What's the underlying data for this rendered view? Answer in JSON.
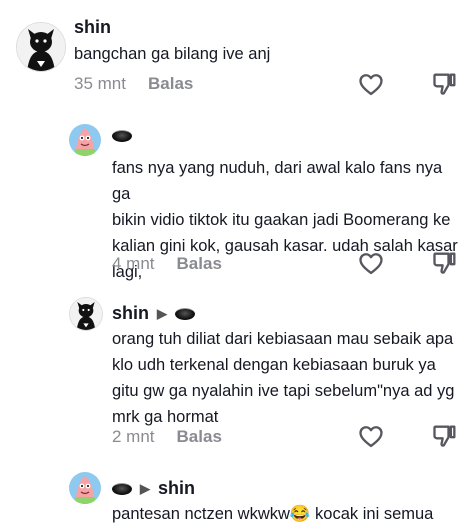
{
  "comments": [
    {
      "user": "shin",
      "text": "bangchan ga bilang ive anj",
      "time": "35 mnt",
      "reply_label": "Balas",
      "avatar": "black-dog-avatar"
    },
    {
      "user": "",
      "user_icon": "black-dot-emoji",
      "text": "fans nya yang nuduh, dari awal kalo fans nya ga\nbikin vidio tiktok itu gaakan jadi Boomerang ke\nkalian gini kok, gausah kasar. udah salah kasar\nlagi,",
      "time": "4 mnt",
      "reply_label": "Balas",
      "avatar": "patrick-avatar"
    },
    {
      "user": "shin",
      "reply_to_icon": "black-dot-emoji",
      "text": "orang tuh diliat dari kebiasaan mau sebaik apa\nklo udh terkenal dengan kebiasaan buruk ya\ngitu gw ga nyalahin ive tapi sebelum\"nya ad yg\nmrk ga hormat",
      "time": "2 mnt",
      "reply_label": "Balas",
      "avatar": "black-dog-avatar"
    },
    {
      "user_icon": "black-dot-emoji",
      "reply_to": "shin",
      "text": "pantesan nctzen wkwkw😂 kocak ini semua",
      "avatar": "patrick-avatar"
    }
  ]
}
